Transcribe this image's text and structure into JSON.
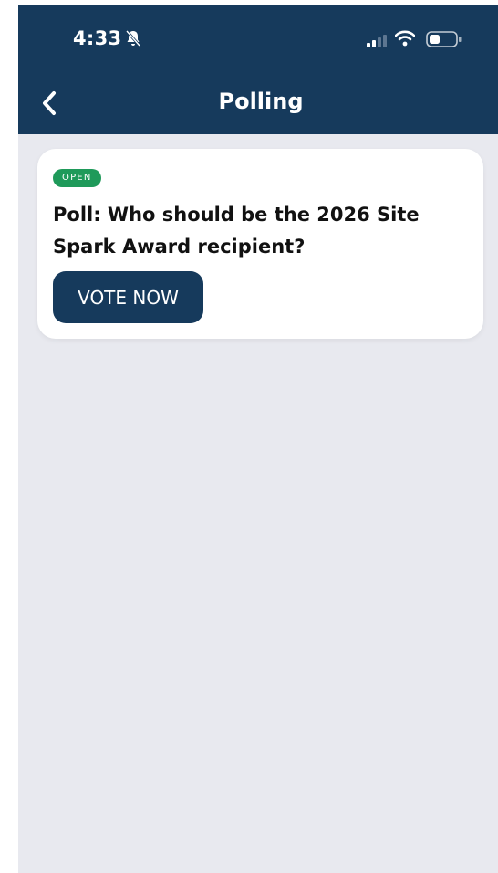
{
  "status_bar": {
    "time": "4:33",
    "icons": [
      "bell-slash-icon",
      "signal-icon",
      "wifi-icon",
      "battery-icon"
    ]
  },
  "header": {
    "title": "Polling",
    "back_icon": "chevron-left-icon"
  },
  "polls": [
    {
      "status": "OPEN",
      "question": "Poll: Who should be the 2026 Site Spark Award recipient?",
      "action_label": "VOTE NOW"
    }
  ],
  "colors": {
    "header_bg": "#163a5c",
    "page_bg": "#e8e9ef",
    "card_bg": "#ffffff",
    "badge_open": "#1f9a5a",
    "button_bg": "#163a5c"
  }
}
